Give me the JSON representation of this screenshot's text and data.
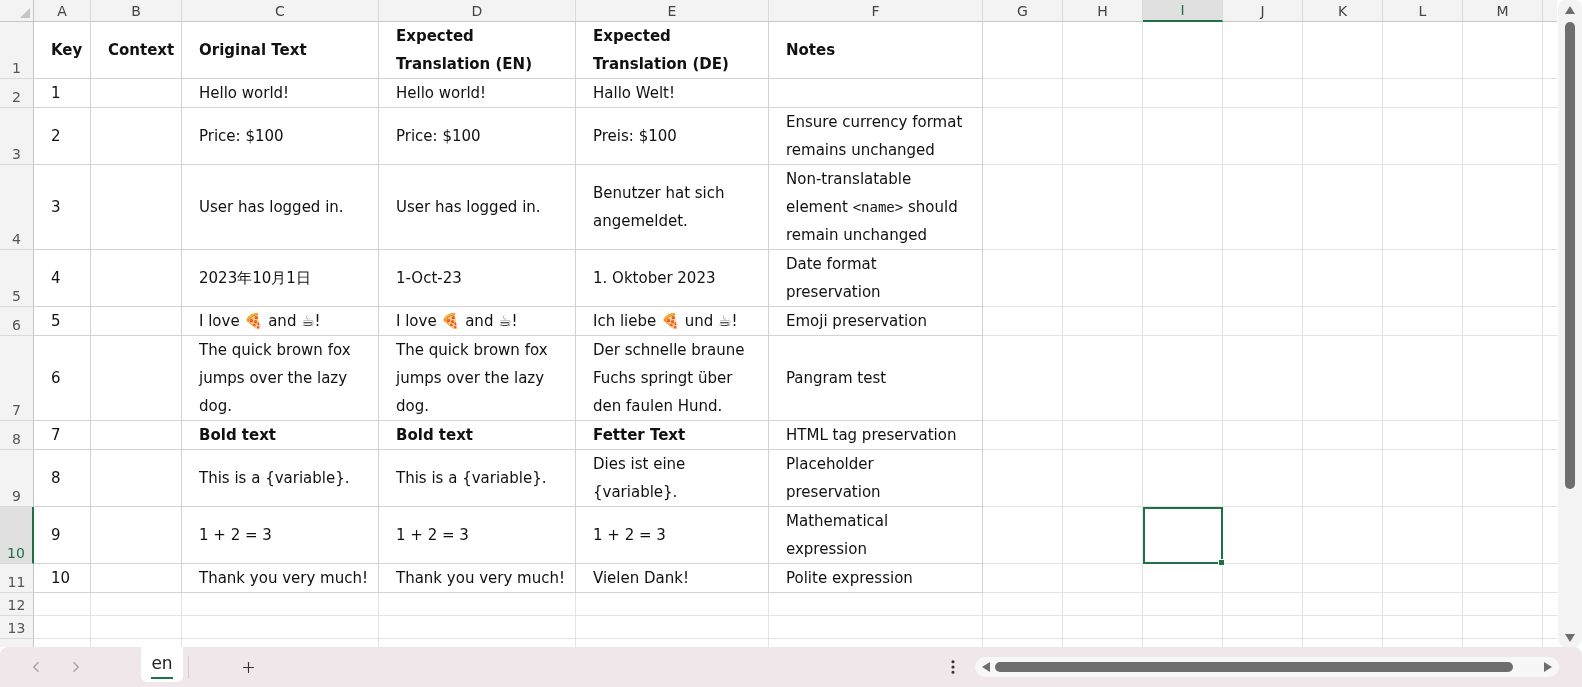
{
  "column_headers": [
    {
      "label": "A",
      "selected": false
    },
    {
      "label": "B",
      "selected": false
    },
    {
      "label": "C",
      "selected": false
    },
    {
      "label": "D",
      "selected": false
    },
    {
      "label": "E",
      "selected": false
    },
    {
      "label": "F",
      "selected": false
    },
    {
      "label": "G",
      "selected": false
    },
    {
      "label": "H",
      "selected": false
    },
    {
      "label": "I",
      "selected": true
    },
    {
      "label": "J",
      "selected": false
    },
    {
      "label": "K",
      "selected": false
    },
    {
      "label": "L",
      "selected": false
    },
    {
      "label": "M",
      "selected": false
    }
  ],
  "rows": [
    {
      "kind": "header",
      "number": "1",
      "selected": false,
      "cells": [
        "Key",
        "Context",
        "Original Text",
        "Expected Translation (EN)",
        "Expected Translation (DE)",
        "Notes"
      ]
    },
    {
      "kind": "entry",
      "number": "2",
      "selected": false,
      "bold": false,
      "key": "1",
      "original_text": "Hello world!",
      "expected_en": "Hello world!",
      "expected_de": "Hallo Welt!"
    },
    {
      "kind": "entry",
      "number": "3",
      "selected": false,
      "bold": false,
      "key": "2",
      "original_text": "Price: $100",
      "expected_en": "Price: $100",
      "expected_de": "Preis: $100",
      "notes": [
        {
          "kind": "text",
          "text": "Ensure currency format remains unchanged"
        }
      ]
    },
    {
      "kind": "entry",
      "number": "4",
      "selected": false,
      "bold": false,
      "key": "3",
      "original_text": "User has logged in.",
      "expected_en": "User has logged in.",
      "expected_de": "Benutzer hat sich angemeldet.",
      "notes": [
        {
          "kind": "text",
          "text": "Non-translatable element "
        },
        {
          "kind": "code",
          "text": "<name>"
        },
        {
          "kind": "text",
          "text": " should remain unchanged"
        }
      ]
    },
    {
      "kind": "entry",
      "number": "5",
      "selected": false,
      "bold": false,
      "key": "4",
      "original_text": "2023年10月1日",
      "expected_en": "1-Oct-23",
      "expected_de": "1. Oktober 2023",
      "notes": [
        {
          "kind": "text",
          "text": "Date format preservation"
        }
      ]
    },
    {
      "kind": "entry",
      "number": "6",
      "selected": false,
      "bold": false,
      "key": "5",
      "original_text": "I love 🍕 and ☕!",
      "expected_en": "I love 🍕 and ☕!",
      "expected_de": "Ich liebe 🍕 und ☕!",
      "notes": [
        {
          "kind": "text",
          "text": "Emoji preservation"
        }
      ]
    },
    {
      "kind": "entry",
      "number": "7",
      "selected": false,
      "bold": false,
      "key": "6",
      "original_text": "The quick brown fox jumps over the lazy dog.",
      "expected_en": "The quick brown fox jumps over the lazy dog.",
      "expected_de": "Der schnelle braune Fuchs springt über den faulen Hund.",
      "notes": [
        {
          "kind": "text",
          "text": "Pangram test"
        }
      ]
    },
    {
      "kind": "entry",
      "number": "8",
      "selected": false,
      "bold": true,
      "key": "7",
      "original_text": "Bold text",
      "expected_en": "Bold text",
      "expected_de": "Fetter Text",
      "notes": [
        {
          "kind": "text",
          "text": "HTML tag preservation"
        }
      ]
    },
    {
      "kind": "entry",
      "number": "9",
      "selected": false,
      "bold": false,
      "key": "8",
      "original_text": "This is a {variable}.",
      "expected_en": "This is a {variable}.",
      "expected_de": "Dies ist eine {variable}.",
      "notes": [
        {
          "kind": "text",
          "text": "Placeholder preservation"
        }
      ]
    },
    {
      "kind": "entry",
      "number": "10",
      "selected": true,
      "bold": false,
      "key": "9",
      "original_text": "1 + 2 = 3",
      "expected_en": "1 + 2 = 3",
      "expected_de": "1 + 2 = 3",
      "notes": [
        {
          "kind": "text",
          "text": "Mathematical expression"
        }
      ]
    },
    {
      "kind": "entry",
      "number": "11",
      "selected": false,
      "bold": false,
      "key": "10",
      "original_text": "Thank you very much!",
      "expected_en": "Thank you very much!",
      "expected_de": "Vielen Dank!",
      "notes": [
        {
          "kind": "text",
          "text": "Polite expression"
        }
      ]
    },
    {
      "kind": "empty",
      "number": "12",
      "selected": false
    },
    {
      "kind": "empty",
      "number": "13",
      "selected": false
    }
  ],
  "sheet_tabs": [
    {
      "label": "en",
      "selected": true
    }
  ]
}
